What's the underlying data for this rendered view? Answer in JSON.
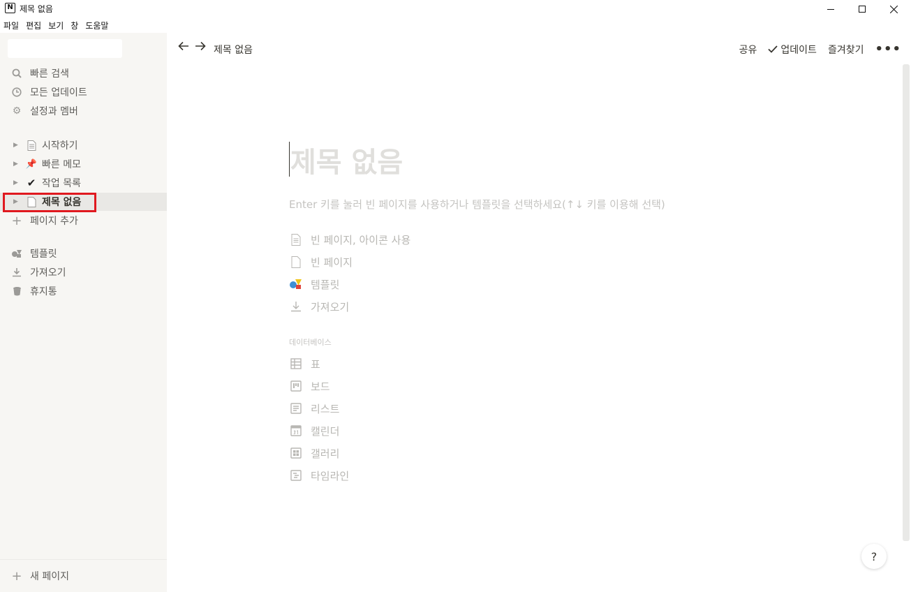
{
  "window": {
    "title": "제목 없음",
    "app_icon": "N"
  },
  "menu": [
    "파일",
    "편집",
    "보기",
    "창",
    "도움말"
  ],
  "sidebar": {
    "actions": [
      {
        "label": "빠른 검색",
        "icon": "search-icon"
      },
      {
        "label": "모든 업데이트",
        "icon": "clock-icon"
      },
      {
        "label": "설정과 멤버",
        "icon": "gear-icon"
      }
    ],
    "pages": [
      {
        "label": "시작하기",
        "icon": "document-icon",
        "glyph": "🗎"
      },
      {
        "label": "빠른 메모",
        "icon": "pin-icon",
        "glyph": "📌"
      },
      {
        "label": "작업 목록",
        "icon": "checkmark-icon",
        "glyph": "✔"
      },
      {
        "label": "제목 없음",
        "icon": "blank-page-icon",
        "glyph": "🗋"
      }
    ],
    "add_page": "페이지 추가",
    "tools": [
      {
        "label": "템플릿",
        "icon": "template-icon"
      },
      {
        "label": "가져오기",
        "icon": "import-icon"
      },
      {
        "label": "휴지통",
        "icon": "trash-icon"
      }
    ],
    "new_page": "새 페이지"
  },
  "topbar": {
    "breadcrumb": "제목 없음",
    "share": "공유",
    "updates": "업데이트",
    "favorite": "즐겨찾기",
    "more": "•••"
  },
  "editor": {
    "title_placeholder": "제목 없음",
    "hint": "Enter 키를 눌러 빈 페이지를 사용하거나 템플릿을 선택하세요(↑↓ 키를 이용해 선택)",
    "options": [
      {
        "label": "빈 페이지, 아이콘 사용",
        "icon": "page-with-icon-icon"
      },
      {
        "label": "빈 페이지",
        "icon": "blank-page-icon"
      },
      {
        "label": "템플릿",
        "icon": "template-icon"
      },
      {
        "label": "가져오기",
        "icon": "import-icon"
      }
    ],
    "database_label": "데이터베이스",
    "databases": [
      {
        "label": "표",
        "icon": "table-icon"
      },
      {
        "label": "보드",
        "icon": "board-icon"
      },
      {
        "label": "리스트",
        "icon": "list-icon"
      },
      {
        "label": "캘린더",
        "icon": "calendar-icon"
      },
      {
        "label": "갤러리",
        "icon": "gallery-icon"
      },
      {
        "label": "타임라인",
        "icon": "timeline-icon"
      }
    ]
  },
  "help": "?"
}
